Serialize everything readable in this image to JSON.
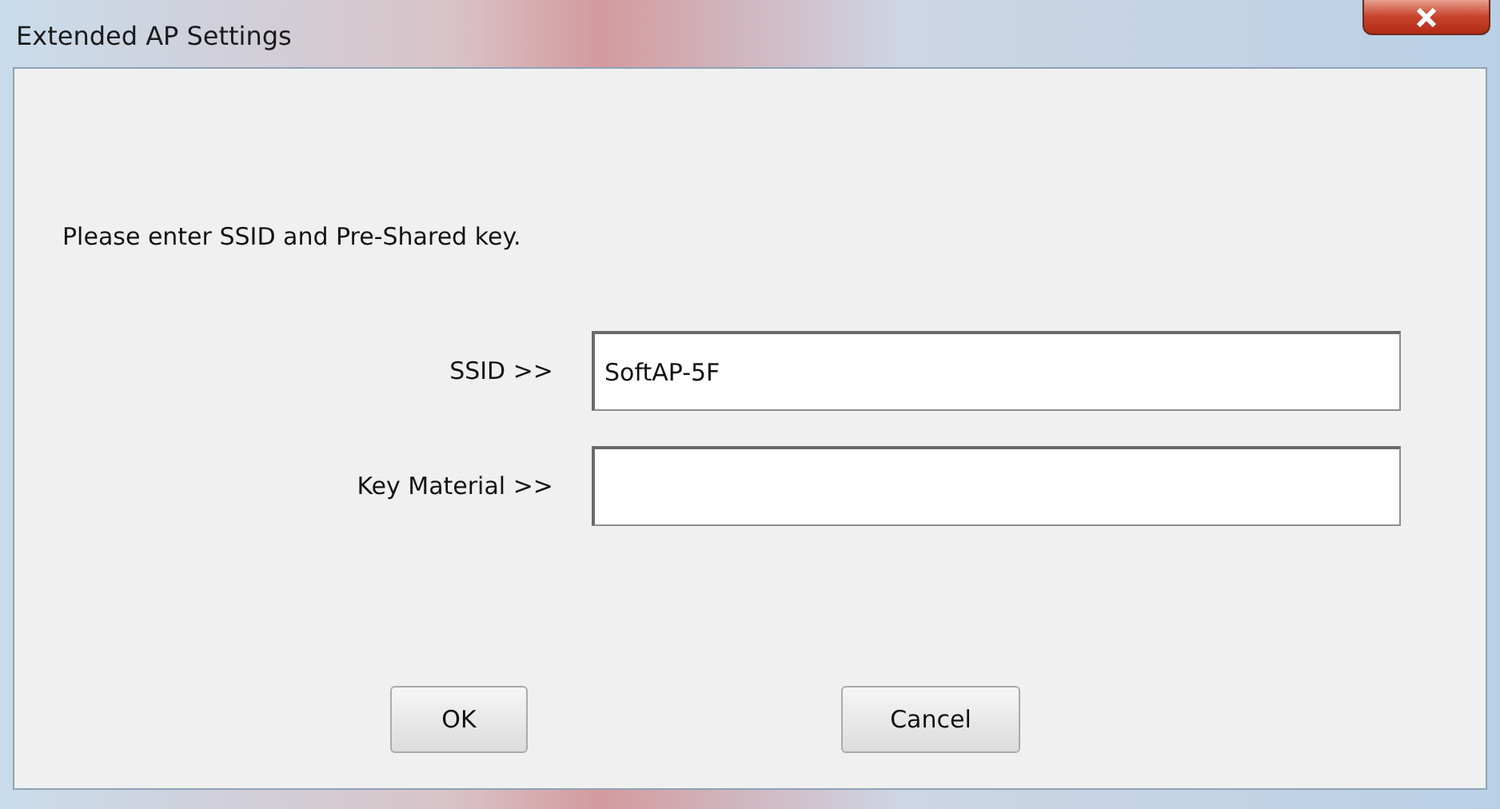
{
  "window": {
    "title": "Extended AP Settings"
  },
  "prompt": "Please enter SSID and Pre-Shared key.",
  "fields": [
    {
      "label": "SSID >>",
      "value": "SoftAP-5F"
    },
    {
      "label": "Key Material >>"
    }
  ],
  "buttons": [
    "OK",
    "Cancel"
  ]
}
